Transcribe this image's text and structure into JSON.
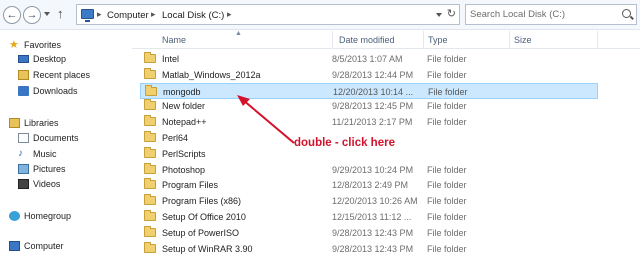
{
  "toolbar": {
    "back_glyph": "←",
    "forward_glyph": "→",
    "up_glyph": "↑",
    "refresh_glyph": "↻"
  },
  "address": {
    "crumbs": [
      "Computer",
      "Local Disk (C:)"
    ],
    "separator": "▸"
  },
  "search": {
    "placeholder": "Search Local Disk (C:)"
  },
  "nav": {
    "favorites": "Favorites",
    "desktop": "Desktop",
    "recent": "Recent places",
    "downloads": "Downloads",
    "libraries": "Libraries",
    "documents": "Documents",
    "music": "Music",
    "pictures": "Pictures",
    "videos": "Videos",
    "homegroup": "Homegroup",
    "computer": "Computer"
  },
  "columns": {
    "name": "Name",
    "date": "Date modified",
    "type": "Type",
    "size": "Size"
  },
  "files": [
    {
      "name": "Intel",
      "date": "8/5/2013 1:07 AM",
      "type": "File folder"
    },
    {
      "name": "Matlab_Windows_2012a",
      "date": "9/28/2013 12:44 PM",
      "type": "File folder"
    },
    {
      "name": "mongodb",
      "date": "12/20/2013 10:14 ...",
      "type": "File folder"
    },
    {
      "name": "New folder",
      "date": "9/28/2013 12:45 PM",
      "type": "File folder"
    },
    {
      "name": "Notepad++",
      "date": "11/21/2013 2:17 PM",
      "type": "File folder"
    },
    {
      "name": "Perl64",
      "date": "",
      "type": ""
    },
    {
      "name": "PerlScripts",
      "date": "",
      "type": ""
    },
    {
      "name": "Photoshop",
      "date": "9/29/2013 10:24 PM",
      "type": "File folder"
    },
    {
      "name": "Program Files",
      "date": "12/8/2013 2:49 PM",
      "type": "File folder"
    },
    {
      "name": "Program Files (x86)",
      "date": "12/20/2013 10:26 AM",
      "type": "File folder"
    },
    {
      "name": "Setup Of Office 2010",
      "date": "12/15/2013 11:12 ...",
      "type": "File folder"
    },
    {
      "name": "Setup of PowerISO",
      "date": "9/28/2013 12:43 PM",
      "type": "File folder"
    },
    {
      "name": "Setup of WinRAR 3.90",
      "date": "9/28/2013 12:43 PM",
      "type": "File folder"
    }
  ],
  "selected_index": 2,
  "annotation": {
    "text": "double - click here",
    "color": "#d3122b"
  }
}
